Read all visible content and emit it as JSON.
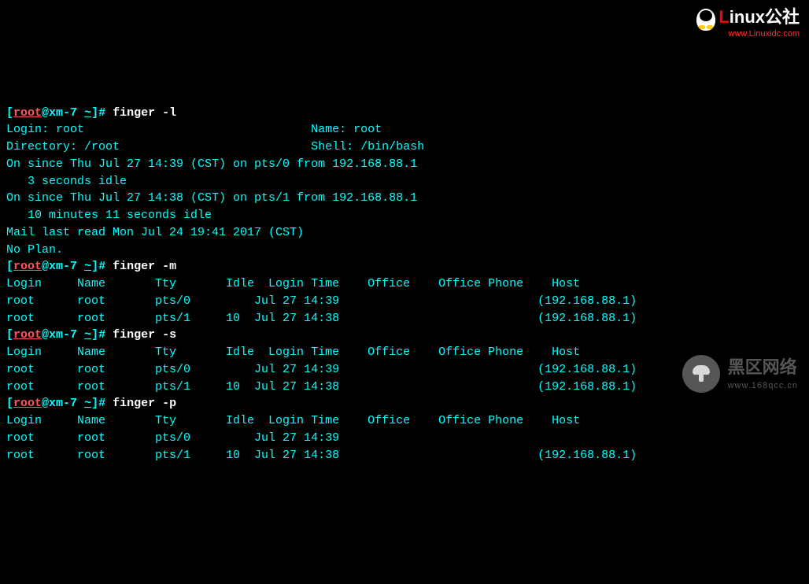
{
  "watermarks": {
    "top": {
      "brand_l": "L",
      "brand_rest": "inux公社",
      "url": "www.Linuxidc.com"
    },
    "bottom": {
      "title": "黑区网络",
      "sub": "www.168qcc.cn"
    }
  },
  "prompt": {
    "user": "root",
    "host": "xm-7",
    "cwd": "~",
    "symbol": "#"
  },
  "cmds": {
    "c1": "finger -l",
    "c2": "finger -m",
    "c3": "finger -s",
    "c4": "finger -p"
  },
  "finger_l": {
    "login_label": "Login:",
    "login": "root",
    "name_label": "Name:",
    "name": "root",
    "dir_label": "Directory:",
    "dir": "/root",
    "shell_label": "Shell:",
    "shell": "/bin/bash",
    "on1": "On since Thu Jul 27 14:39 (CST) on pts/0 from 192.168.88.1",
    "idle1": "   3 seconds idle",
    "on2": "On since Thu Jul 27 14:38 (CST) on pts/1 from 192.168.88.1",
    "idle2": "   10 minutes 11 seconds idle",
    "mail": "Mail last read Mon Jul 24 19:41 2017 (CST)",
    "noplan": "No Plan."
  },
  "hdr": {
    "login": "Login",
    "name": "Name",
    "tty": "Tty",
    "idle": "Idle",
    "ltime": "Login Time",
    "office": "Office",
    "ophone": "Office Phone",
    "host": "Host"
  },
  "rows_m": [
    {
      "login": "root",
      "name": "root",
      "tty": "pts/0",
      "idle": "",
      "ltime": "Jul 27 14:39",
      "host": "(192.168.88.1)"
    },
    {
      "login": "root",
      "name": "root",
      "tty": "pts/1",
      "idle": "10",
      "ltime": "Jul 27 14:38",
      "host": "(192.168.88.1)"
    }
  ],
  "rows_s": [
    {
      "login": "root",
      "name": "root",
      "tty": "pts/0",
      "idle": "",
      "ltime": "Jul 27 14:39",
      "host": "(192.168.88.1)"
    },
    {
      "login": "root",
      "name": "root",
      "tty": "pts/1",
      "idle": "10",
      "ltime": "Jul 27 14:38",
      "host": "(192.168.88.1)"
    }
  ],
  "rows_p": [
    {
      "login": "root",
      "name": "root",
      "tty": "pts/0",
      "idle": "",
      "ltime": "Jul 27 14:39",
      "host": ""
    },
    {
      "login": "root",
      "name": "root",
      "tty": "pts/1",
      "idle": "10",
      "ltime": "Jul 27 14:38",
      "host": "(192.168.88.1)"
    }
  ]
}
